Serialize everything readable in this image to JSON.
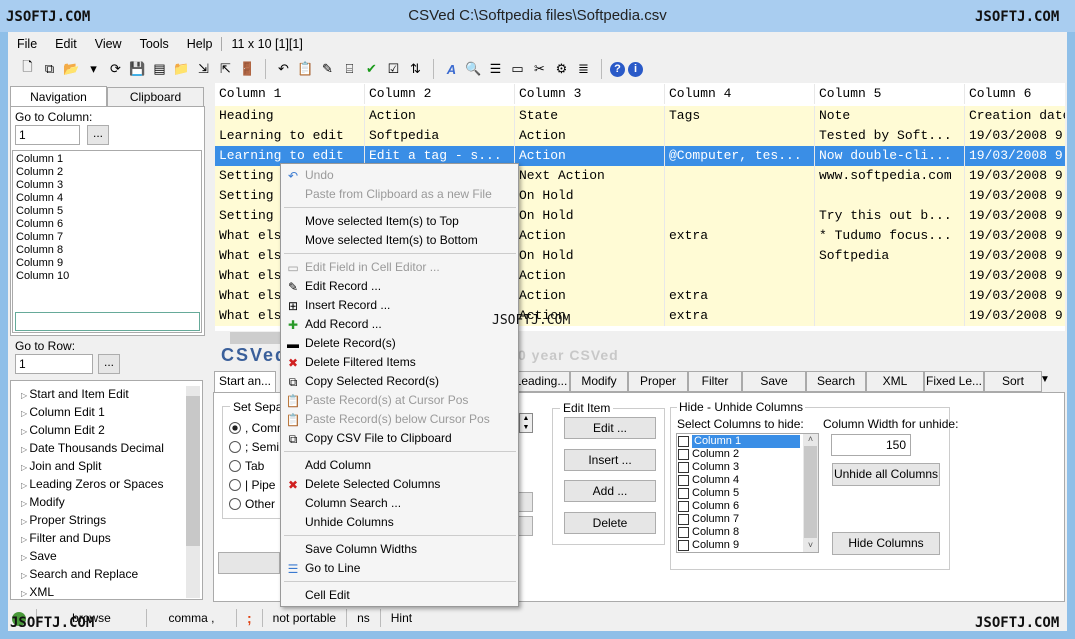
{
  "window": {
    "title": "CSVed C:\\Softpedia files\\Softpedia.csv",
    "watermark": "JSOFTJ.COM"
  },
  "menubar": {
    "items": [
      "File",
      "Edit",
      "View",
      "Tools",
      "Help"
    ],
    "info": "11 x 10 [1][1]"
  },
  "toolbar": {
    "icons": [
      "new-file-icon",
      "copy-icon",
      "open-folder-icon",
      "dropdown-icon",
      "refresh-icon",
      "save-icon",
      "save-as-icon",
      "folder-icon",
      "import-icon",
      "export-icon",
      "exit-door-icon",
      "undo-icon",
      "paste-icon",
      "edit-icon",
      "rename-icon",
      "check-icon",
      "check-box-icon",
      "sort-az-icon",
      "font-icon",
      "search-icon",
      "columns-icon",
      "cell-editor-icon",
      "tools-icon",
      "settings-icon",
      "list-icon",
      "help-icon",
      "info-icon"
    ]
  },
  "left": {
    "tabs": [
      "Navigation",
      "Clipboard"
    ],
    "go_to_column_label": "Go to Column:",
    "go_to_column_value": "1",
    "browse_label": "...",
    "columns": [
      "Column 1",
      "Column 2",
      "Column 3",
      "Column 4",
      "Column 5",
      "Column 6",
      "Column 7",
      "Column 8",
      "Column 9",
      "Column 10"
    ],
    "go_to_row_label": "Go to Row:",
    "go_to_row_value": "1",
    "tree": [
      "Start and Item Edit",
      "Column Edit 1",
      "Column Edit 2",
      "Date Thousands Decimal",
      "Join and Split",
      "Leading Zeros or Spaces",
      "Modify",
      "Proper Strings",
      "Filter and Dups",
      "Save",
      "Search and Replace",
      "XML"
    ]
  },
  "grid": {
    "headers": [
      "Column 1",
      "Column 2",
      "Column 3",
      "Column 4",
      "Column 5",
      "Column 6"
    ],
    "rows": [
      [
        "Heading",
        "Action",
        "State",
        "Tags",
        "Note",
        "Creation date"
      ],
      [
        "Learning to edit",
        "Softpedia",
        "Action",
        "",
        "Tested by Soft...",
        "19/03/2008 9"
      ],
      [
        "Learning to edit",
        "Edit a tag - s...",
        "Action",
        "@Computer, tes...",
        "Now double-cli...",
        "19/03/2008 9"
      ],
      [
        "Setting",
        "",
        "Next Action",
        "",
        "www.softpedia.com",
        "19/03/2008 9"
      ],
      [
        "Setting",
        "",
        "On Hold",
        "",
        "",
        "19/03/2008 9"
      ],
      [
        "Setting",
        "",
        "On Hold",
        "",
        "Try this out b...",
        "19/03/2008 9"
      ],
      [
        "What els",
        "",
        "Action",
        "extra",
        "* Tudumo focus...",
        "19/03/2008 9"
      ],
      [
        "What els",
        "",
        "On Hold",
        "",
        "Softpedia",
        "19/03/2008 9"
      ],
      [
        "What els",
        "",
        "Action",
        "",
        "",
        "19/03/2008 9"
      ],
      [
        "What els",
        "",
        "Action",
        "extra",
        "",
        "19/03/2008 9"
      ],
      [
        "What els",
        "",
        "Action",
        "extra",
        "",
        "19/03/2008 9"
      ]
    ],
    "selected_row": 2
  },
  "banner": {
    "logo": "CSVed",
    "tagline": "0 year CSVed"
  },
  "tabs": [
    "Start an...",
    "Leading...",
    "Modify",
    "Proper",
    "Filter an...",
    "Save",
    "Search a...",
    "XML",
    "Fixed Le...",
    "Sort"
  ],
  "separator": {
    "label": "Set Separ",
    "options": [
      ", Comm",
      "; Semi",
      "Tab",
      "| Pipe",
      "Other"
    ],
    "selected": 0
  },
  "edit_item": {
    "label": "Edit Item",
    "buttons": [
      "Edit ...",
      "Insert ...",
      "Add ...",
      "Delete"
    ]
  },
  "hide": {
    "label": "Hide - Unhide Columns",
    "select_label": "Select Columns to hide:",
    "columns": [
      "Column 1",
      "Column 2",
      "Column 3",
      "Column 4",
      "Column 5",
      "Column 6",
      "Column 7",
      "Column 8",
      "Column 9"
    ],
    "width_label": "Column Width for unhide:",
    "width_value": "150",
    "unhide_all": "Unhide all Columns",
    "hide_button": "Hide Columns"
  },
  "context_menu": {
    "items": [
      {
        "label": "Undo",
        "icon": "undo-icon",
        "disabled": true
      },
      {
        "label": "Paste from Clipboard as a new File",
        "disabled": true
      },
      {
        "sep": true
      },
      {
        "label": "Move selected Item(s) to Top"
      },
      {
        "label": "Move selected Item(s) to Bottom"
      },
      {
        "sep": true
      },
      {
        "label": "Edit Field in Cell Editor ...",
        "icon": "cell-editor-icon",
        "disabled": true
      },
      {
        "label": "Edit Record ...",
        "icon": "edit-icon"
      },
      {
        "label": "Insert Record ...",
        "icon": "insert-icon"
      },
      {
        "label": "Add Record ...",
        "icon": "add-icon"
      },
      {
        "label": "Delete Record(s)",
        "icon": "delete-record-icon"
      },
      {
        "label": "Delete Filtered Items",
        "icon": "delete-x-icon"
      },
      {
        "label": "Copy Selected Record(s)",
        "icon": "copy-icon"
      },
      {
        "label": "Paste Record(s) at Cursor Pos",
        "icon": "paste-icon",
        "disabled": true
      },
      {
        "label": "Paste Record(s) below Cursor Pos",
        "icon": "paste-icon",
        "disabled": true
      },
      {
        "label": "Copy CSV File to Clipboard",
        "icon": "copy-icon"
      },
      {
        "sep": true
      },
      {
        "label": "Add Column"
      },
      {
        "label": "Delete Selected Columns",
        "icon": "delete-x-icon"
      },
      {
        "label": "Column Search ..."
      },
      {
        "label": "Unhide Columns"
      },
      {
        "sep": true
      },
      {
        "label": "Save Column Widths"
      },
      {
        "label": "Go to Line",
        "icon": "go-to-line-icon"
      },
      {
        "sep": true
      },
      {
        "label": "Cell Edit"
      }
    ]
  },
  "statusbar": {
    "items": [
      "browse",
      "comma ,",
      ";",
      "not portable",
      "ns",
      "Hint"
    ]
  },
  "colors": {
    "selection": "#3a8ee6",
    "row_alt": "#fffbd5",
    "titlebar": "#a9cdf0",
    "semicolon": "#e04010"
  }
}
